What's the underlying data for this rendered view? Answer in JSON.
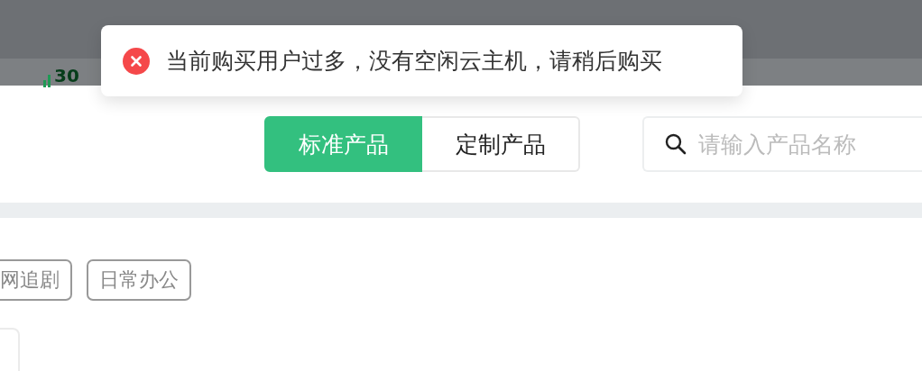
{
  "backdrop": {
    "reading": "30"
  },
  "toast": {
    "kind": "error",
    "message": "当前购买用户过多，没有空闲云主机，请稍后购买"
  },
  "tabs": [
    {
      "label": "标准产品",
      "selected": true
    },
    {
      "label": "定制产品",
      "selected": false
    }
  ],
  "search": {
    "placeholder": "请输入产品名称"
  },
  "tags": [
    {
      "label": "网追剧"
    },
    {
      "label": "日常办公"
    }
  ]
}
